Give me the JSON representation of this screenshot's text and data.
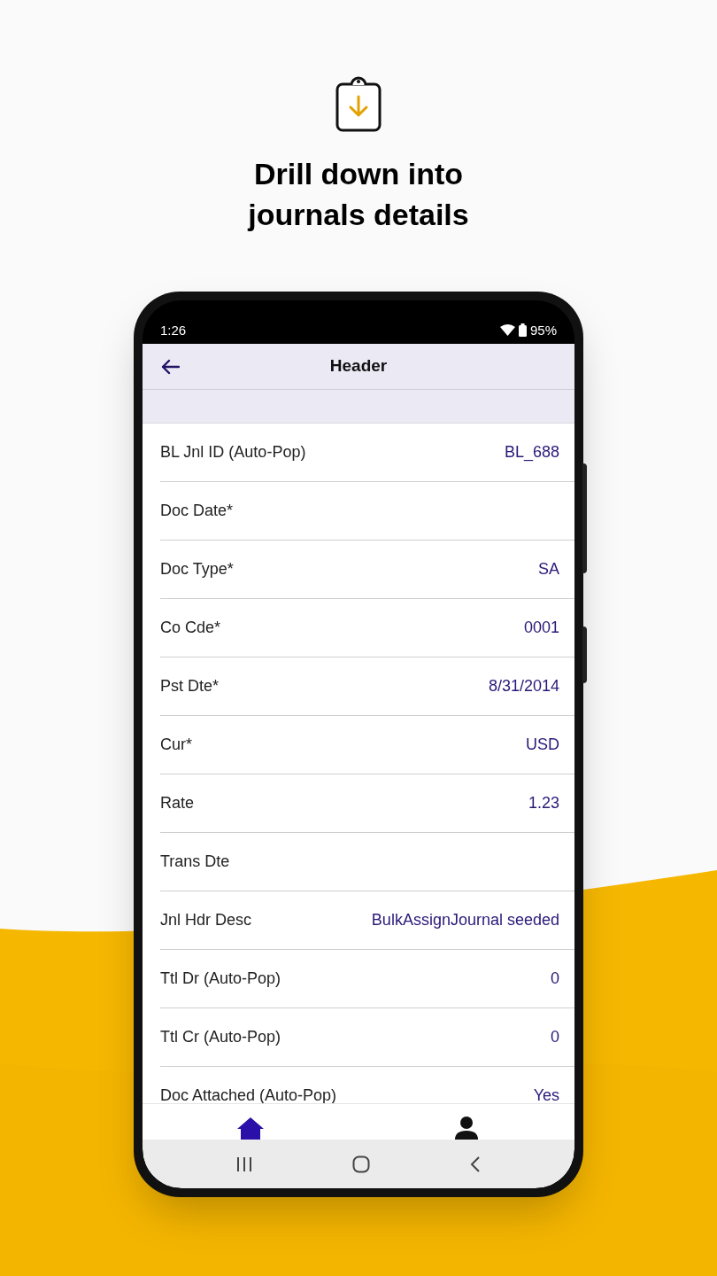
{
  "promo": {
    "headline": [
      "Drill down into",
      "journals details"
    ]
  },
  "status_bar": {
    "time": "1:26",
    "battery": "95%"
  },
  "app_bar": {
    "title": "Header"
  },
  "fields": [
    {
      "label": "BL Jnl ID (Auto-Pop)",
      "value": "BL_688"
    },
    {
      "label": "Doc Date*"
    },
    {
      "label": "Doc Type*",
      "value": "SA"
    },
    {
      "label": "Co Cde*",
      "value": "0001"
    },
    {
      "label": "Pst Dte*",
      "value": "8/31/2014"
    },
    {
      "label": "Cur*",
      "value": "USD"
    },
    {
      "label": "Rate",
      "value": "1.23"
    },
    {
      "label": "Trans Dte"
    },
    {
      "label": "Jnl Hdr Desc",
      "value": "BulkAssignJournal seeded"
    },
    {
      "label": "Ttl Dr (Auto-Pop)",
      "value": "0"
    },
    {
      "label": "Ttl Cr (Auto-Pop)",
      "value": "0"
    },
    {
      "label": "Doc Attached (Auto-Pop)",
      "value": "Yes"
    }
  ],
  "bottom_nav": [
    {
      "kind": "home",
      "selected": true
    },
    {
      "kind": "profile",
      "selected": false
    }
  ]
}
